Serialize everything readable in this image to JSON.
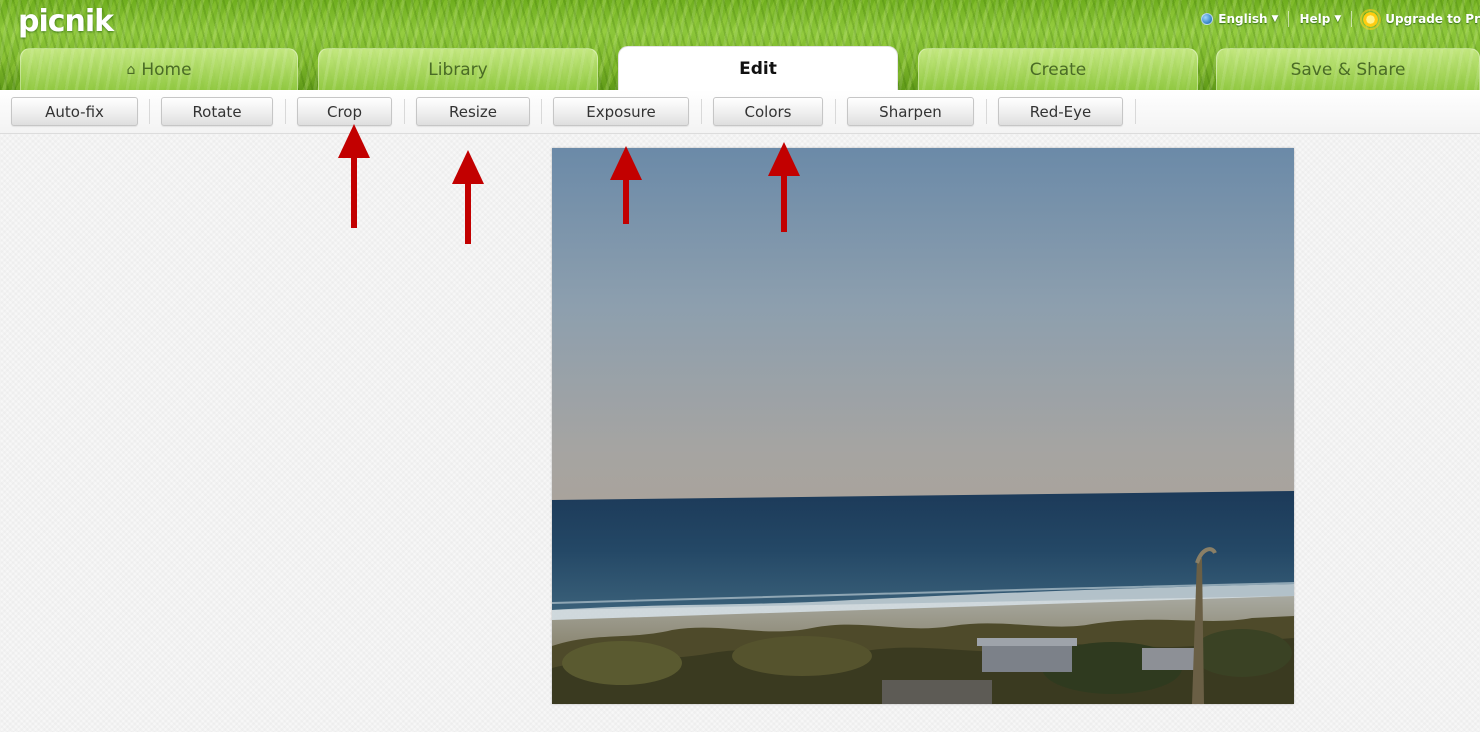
{
  "app": {
    "logo": "picnik"
  },
  "topnav": {
    "language": "English",
    "help": "Help",
    "upgrade": "Upgrade to Pr"
  },
  "tabs": [
    {
      "label": "Home",
      "icon": "house-icon",
      "active": false
    },
    {
      "label": "Library",
      "active": false
    },
    {
      "label": "Edit",
      "active": true
    },
    {
      "label": "Create",
      "active": false
    },
    {
      "label": "Save & Share",
      "active": false
    }
  ],
  "toolbar": {
    "buttons": [
      {
        "label": "Auto-fix"
      },
      {
        "label": "Rotate"
      },
      {
        "label": "Crop"
      },
      {
        "label": "Resize"
      },
      {
        "label": "Exposure"
      },
      {
        "label": "Colors"
      },
      {
        "label": "Sharpen"
      },
      {
        "label": "Red-Eye"
      }
    ]
  },
  "photo": {
    "subject": "ocean-beach-photo"
  },
  "annotations": {
    "arrow_color": "#c00000",
    "arrows_point_to": [
      "Crop",
      "Resize",
      "Exposure",
      "Colors"
    ]
  },
  "colors": {
    "header_green": "#7bb52a",
    "active_tab": "#ffffff",
    "toolbar_bg": "#f3f3f3"
  }
}
